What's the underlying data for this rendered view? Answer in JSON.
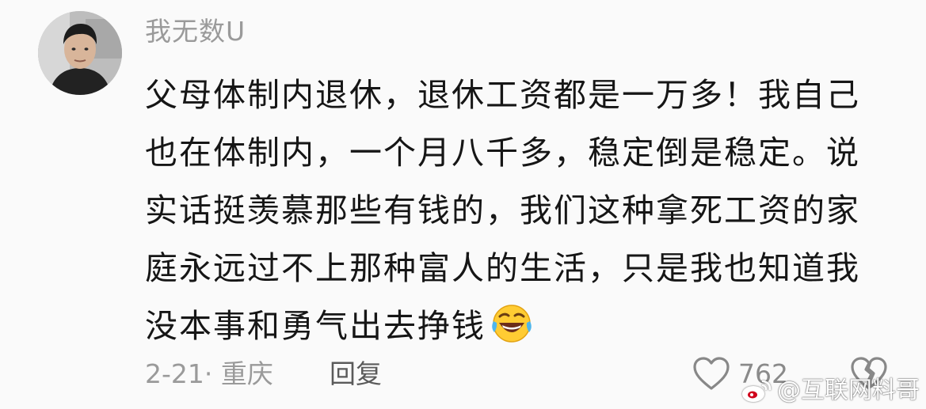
{
  "comment": {
    "username": "我无数U",
    "lines": [
      "父母体制内退休，退休工资都是一万多！我自己",
      "也在体制内，一个月八千多，稳定倒是稳定。说",
      "实话挺羡慕那些有钱的，我们这种拿死工资的家",
      "庭永远过不上那种富人的生活，只是我也知道我",
      "没本事和勇气出去挣钱"
    ],
    "emoji": "rofl-face-icon",
    "date": "2-21",
    "separator": "·",
    "location": "重庆",
    "reply_label": "回复",
    "like_count": "762"
  },
  "watermark": {
    "text": "@互联网料哥"
  },
  "colors": {
    "background": "#fafafa",
    "text": "#161616",
    "muted": "#9a9a9a"
  }
}
